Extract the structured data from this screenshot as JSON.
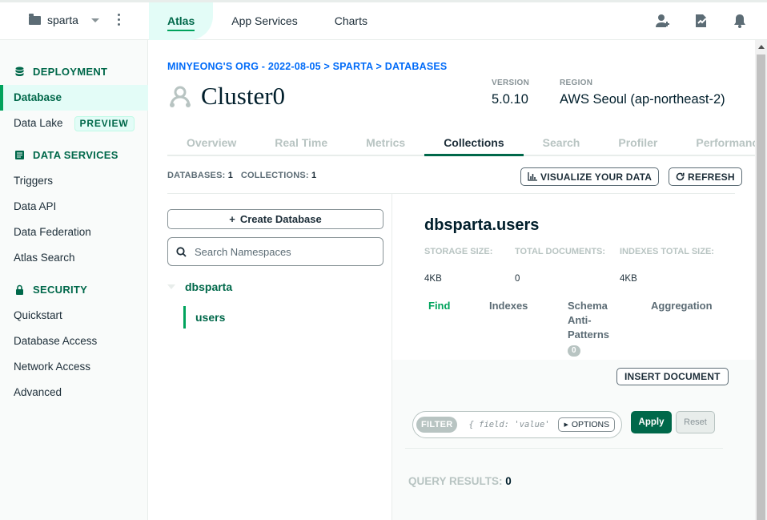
{
  "topbar": {
    "project": "sparta",
    "nav": [
      "Atlas",
      "App Services",
      "Charts"
    ],
    "active_nav": "Atlas",
    "icons": [
      "invite-user-icon",
      "activity-feed-icon",
      "notifications-icon"
    ]
  },
  "sidebar": {
    "deployment": {
      "title": "DEPLOYMENT",
      "items": [
        {
          "label": "Database",
          "active": true
        },
        {
          "label": "Data Lake",
          "badge": "PREVIEW"
        }
      ]
    },
    "data_services": {
      "title": "DATA SERVICES",
      "items": [
        {
          "label": "Triggers"
        },
        {
          "label": "Data API"
        },
        {
          "label": "Data Federation"
        },
        {
          "label": "Atlas Search"
        }
      ]
    },
    "security": {
      "title": "SECURITY",
      "items": [
        {
          "label": "Quickstart"
        },
        {
          "label": "Database Access"
        },
        {
          "label": "Network Access"
        },
        {
          "label": "Advanced"
        }
      ]
    }
  },
  "main": {
    "breadcrumb": "MINYEONG'S ORG - 2022-08-05 > SPARTA > DATABASES",
    "cluster_name": "Cluster0",
    "version_label": "VERSION",
    "version": "5.0.10",
    "region_label": "REGION",
    "region": "AWS Seoul (ap-northeast-2)",
    "tabs": [
      "Overview",
      "Real Time",
      "Metrics",
      "Collections",
      "Search",
      "Profiler",
      "Performance"
    ],
    "active_tab": "Collections",
    "stats": {
      "databases_label": "DATABASES:",
      "databases": "1",
      "collections_label": "COLLECTIONS:",
      "collections": "1"
    },
    "visualize_label": "VISUALIZE YOUR DATA",
    "refresh_label": "REFRESH",
    "create_db_label": "Create Database",
    "search_placeholder": "Search Namespaces",
    "tree": {
      "database": "dbsparta",
      "collection": "users"
    },
    "collection": {
      "title": "dbsparta.users",
      "storage_label": "STORAGE SIZE:",
      "storage": "4KB",
      "docs_label": "TOTAL DOCUMENTS:",
      "docs": "0",
      "indexes_label": "INDEXES TOTAL SIZE:",
      "indexes": "4KB",
      "subtabs": {
        "find": "Find",
        "indexes": "Indexes",
        "schema_1": "Schema",
        "schema_2": "Anti-",
        "schema_3": "Patterns",
        "schema_count": "0",
        "aggregation": "Aggregation"
      }
    },
    "panel": {
      "insert_label": "INSERT DOCUMENT",
      "filter_label": "FILTER",
      "filter_placeholder": "{ field: 'value'",
      "options_label": "OPTIONS",
      "apply_label": "Apply",
      "reset_label": "Reset",
      "query_results_label": "QUERY RESULTS:",
      "query_results": "0"
    }
  }
}
